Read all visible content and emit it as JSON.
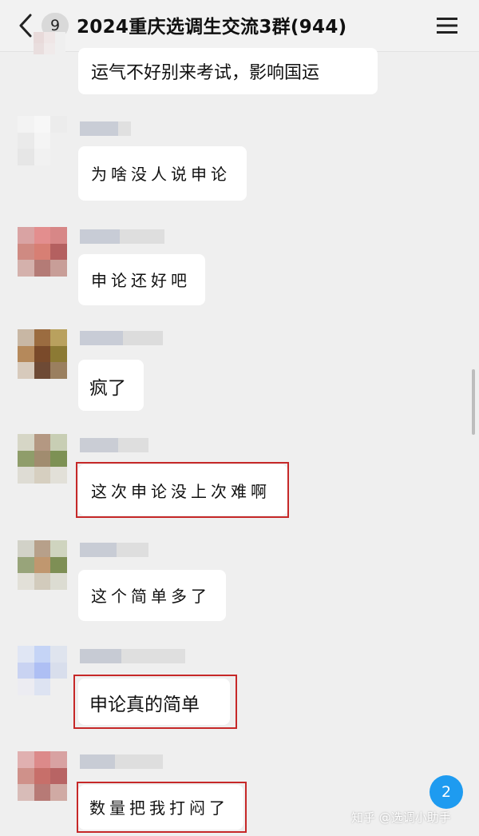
{
  "header": {
    "back_label": "<",
    "unread_count": "9",
    "title": "2024重庆选调生交流3群(944)"
  },
  "messages": [
    {
      "text": "运气不好别来考试，影响国运",
      "highlighted": false
    },
    {
      "text": "为啥没人说申论",
      "highlighted": false
    },
    {
      "text": "申论还好吧",
      "highlighted": false
    },
    {
      "text": "疯了",
      "highlighted": false
    },
    {
      "text": "这次申论没上次难啊",
      "highlighted": true
    },
    {
      "text": "这个简单多了",
      "highlighted": false
    },
    {
      "text": "申论真的简单",
      "highlighted": true
    },
    {
      "text": "数量把我打闷了",
      "highlighted": true
    }
  ],
  "new_message_badge": "2",
  "watermark": "知乎 @选调小助手",
  "colors": {
    "background": "#efefef",
    "bubble": "#ffffff",
    "highlight_box": "#c62828",
    "badge": "#1e9bf0"
  }
}
